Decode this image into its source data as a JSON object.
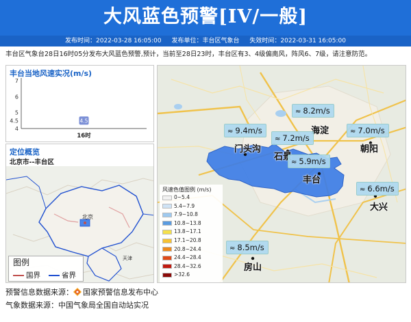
{
  "header": {
    "title": "大风蓝色预警[IV/一般]",
    "publish_time": "发布时间：2022-03-28 16:05:00",
    "publisher": "发布单位：丰台区气象台",
    "expire_time": "失效时间：2022-03-31 16:05:00"
  },
  "description": "丰台区气象台28日16时05分发布大风蓝色预警,预计，当前至28日23时，丰台区有3、4级偏南风，阵风6、7级，请注意防范。",
  "wind_panel": {
    "title": "丰台当地风速实况(m/s)",
    "chart_data": {
      "type": "bar",
      "categories": [
        "16时"
      ],
      "values": [
        4.5
      ],
      "data_labels": [
        "4.5"
      ],
      "yticks": [
        "7",
        "6",
        "5",
        "4.5",
        "4"
      ],
      "ylim": [
        4,
        7
      ],
      "ylabel": "",
      "xlabel": "",
      "title": "丰台当地风速实况(m/s)",
      "bar_color": "#7b8fd6"
    }
  },
  "location_panel": {
    "title": "定位概览",
    "subtitle": "北京市--丰台区",
    "map_labels": {
      "beijing": "北京",
      "tianjin": "天津"
    },
    "legend": {
      "title": "图例",
      "items": [
        {
          "label": "国界",
          "color": "#c0504d"
        },
        {
          "label": "省界",
          "color": "#1f4fd0"
        }
      ]
    }
  },
  "main_map": {
    "districts": [
      "门头沟",
      "石景",
      "海淀",
      "朝阳",
      "丰台",
      "大兴",
      "房山"
    ],
    "wind_readings": [
      {
        "value": "8.2m/s"
      },
      {
        "value": "9.4m/s"
      },
      {
        "value": "7.2m/s"
      },
      {
        "value": "7.0m/s"
      },
      {
        "value": "5.9m/s"
      },
      {
        "value": "6.6m/s"
      },
      {
        "value": "8.5m/s"
      }
    ],
    "wind_icon": "wind-icon",
    "highlight_color": "#3d7de6",
    "legend": {
      "title": "风速色值图例 (m/s)",
      "items": [
        {
          "label": "0~5.4",
          "color": "#f2f2f2"
        },
        {
          "label": "5.4~7.9",
          "color": "#cfe3f5"
        },
        {
          "label": "7.9~10.8",
          "color": "#9ec9ef"
        },
        {
          "label": "10.8~13.8",
          "color": "#5a9be0"
        },
        {
          "label": "13.8~17.1",
          "color": "#f5e04a"
        },
        {
          "label": "17.1~20.8",
          "color": "#f7c232"
        },
        {
          "label": "20.8~24.4",
          "color": "#ef8a1c"
        },
        {
          "label": "24.4~28.4",
          "color": "#e04a18"
        },
        {
          "label": "28.4~32.6",
          "color": "#c01a10"
        },
        {
          "label": ">32.6",
          "color": "#8a0a08"
        }
      ]
    }
  },
  "footer": {
    "warning_source_label": "预警信息数据来源：",
    "warning_source": "国家预警信息发布中心",
    "weather_source": "气象数据来源：中国气象局全国自动站实况"
  }
}
